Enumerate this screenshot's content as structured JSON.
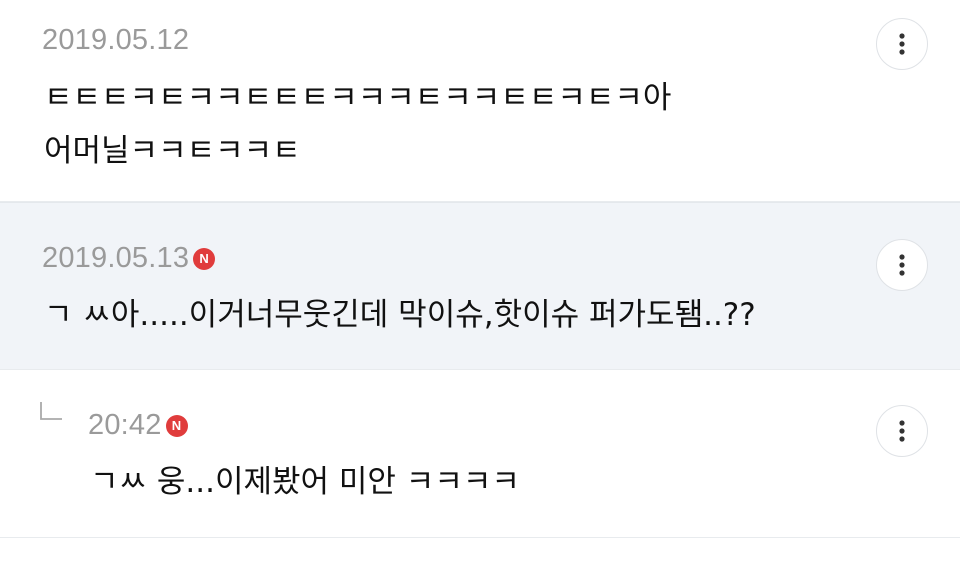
{
  "colors": {
    "badge": "#e03c3c",
    "highlight_bg": "#f1f4f8",
    "date_text": "#9a9a9a"
  },
  "comments": [
    {
      "date": "2019.05.12",
      "lines": [
        "ㅌㅌㅌㅋㅌㅋㅋㅌㅌㅌㅋㅋㅋㅌㅋㅋㅌㅌㅋㅌㅋ아",
        "어머닐ㅋㅋㅌㅋㅋㅌ"
      ],
      "more_icon": "more-vertical-icon"
    },
    {
      "date": "2019.05.13",
      "badge": "N",
      "lines": [
        "ㄱ ㅆ아.....이거너무웃긴데 막이슈,핫이슈 퍼가도됌..??"
      ],
      "more_icon": "more-vertical-icon"
    },
    {
      "date": "20:42",
      "badge": "N",
      "reply_icon": "reply-arrow-icon",
      "lines": [
        "ㄱㅆ 웅...이제봤어 미안 ㅋㅋㅋㅋ"
      ],
      "more_icon": "more-vertical-icon"
    }
  ]
}
